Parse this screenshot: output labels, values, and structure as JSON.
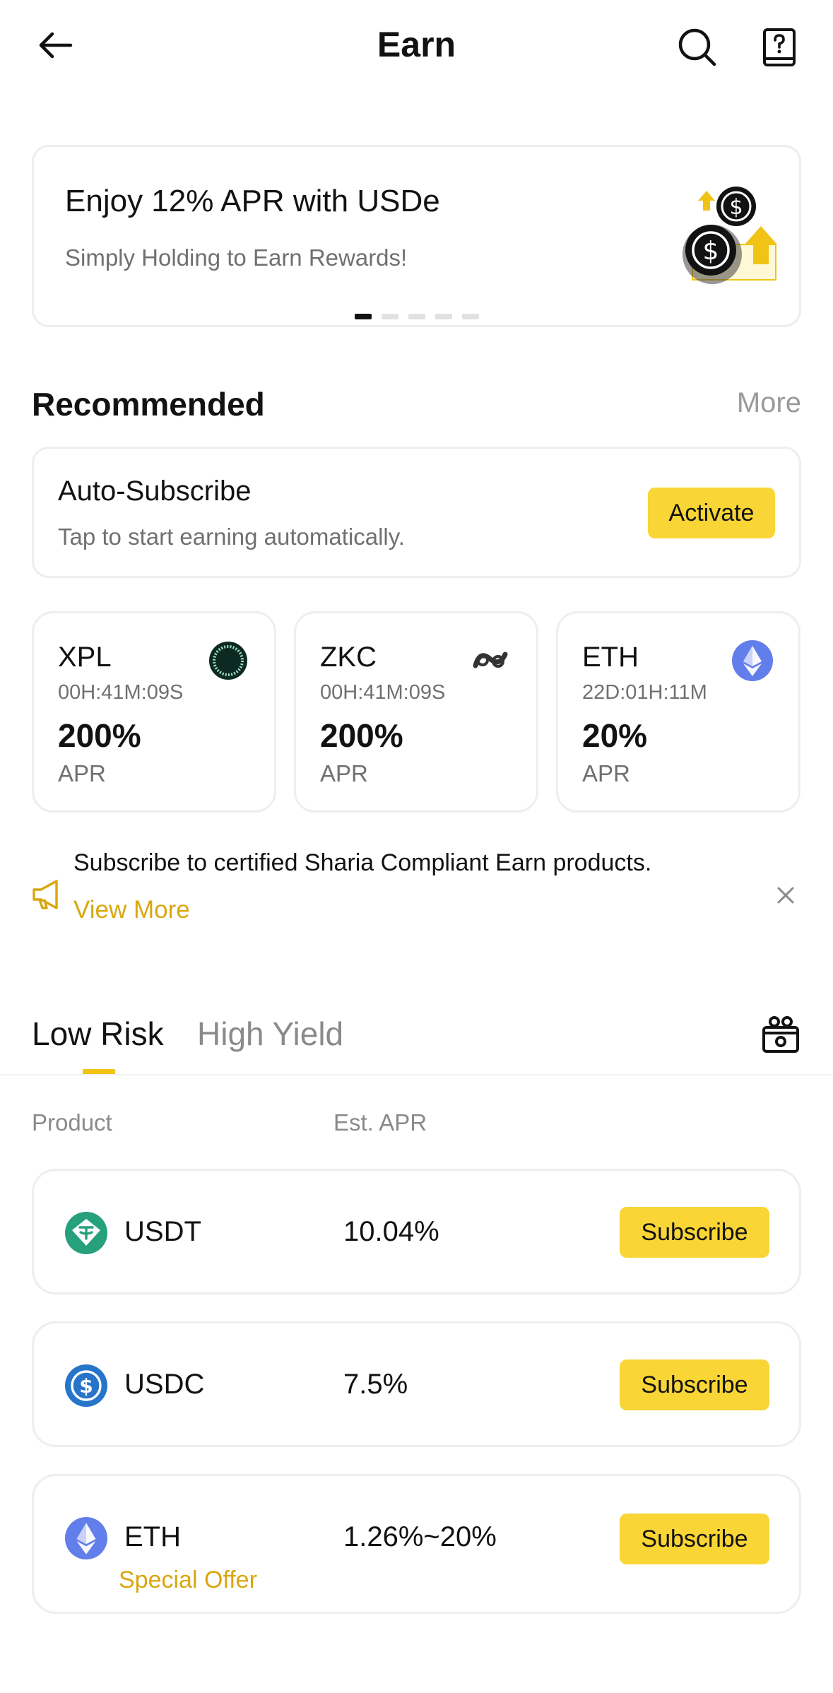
{
  "header": {
    "title": "Earn"
  },
  "banner": {
    "title": "Enjoy 12% APR with USDe",
    "subtitle": "Simply Holding to Earn Rewards!",
    "page_count": 5,
    "active_page": 1
  },
  "recommended": {
    "title": "Recommended",
    "more": "More",
    "auto_subscribe": {
      "title": "Auto-Subscribe",
      "subtitle": "Tap to start earning automatically.",
      "button": "Activate"
    },
    "coins": [
      {
        "name": "XPL",
        "timer": "00H:41M:09S",
        "apr": "200%",
        "apr_label": "APR",
        "icon": "xpl-icon"
      },
      {
        "name": "ZKC",
        "timer": "00H:41M:09S",
        "apr": "200%",
        "apr_label": "APR",
        "icon": "zkc-icon"
      },
      {
        "name": "ETH",
        "timer": "22D:01H:11M",
        "apr": "20%",
        "apr_label": "APR",
        "icon": "eth-icon"
      }
    ]
  },
  "notice": {
    "text": "Subscribe to certified Sharia Compliant Earn products.",
    "link": "View More"
  },
  "tabs": {
    "low_risk": "Low Risk",
    "high_yield": "High Yield",
    "active": "Low Risk"
  },
  "table": {
    "col_product": "Product",
    "col_apr": "Est. APR",
    "rows": [
      {
        "name": "USDT",
        "apr": "10.04%",
        "button": "Subscribe",
        "icon": "usdt-icon"
      },
      {
        "name": "USDC",
        "apr": "7.5%",
        "button": "Subscribe",
        "icon": "usdc-icon"
      },
      {
        "name": "ETH",
        "apr": "1.26%~20%",
        "button": "Subscribe",
        "tag": "Special Offer",
        "icon": "eth-icon"
      }
    ]
  },
  "colors": {
    "accent": "#f9d535",
    "link": "#d8a70f",
    "muted": "#707070"
  }
}
